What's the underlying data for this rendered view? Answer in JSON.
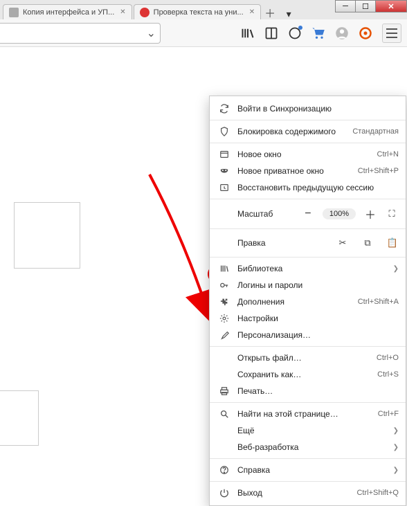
{
  "tabs": [
    {
      "title": "Копия интерфейса и УП..."
    },
    {
      "title": "Проверка текста на уни..."
    }
  ],
  "toolbar_icons": {
    "library": "library-icon",
    "reader": "reader-icon",
    "account_dot": "account-dot-icon",
    "cart": "cart-icon",
    "profile": "profile-icon",
    "orange": "orange-circle-icon"
  },
  "menu": {
    "sync": "Войти в Синхронизацию",
    "block": "Блокировка содержимого",
    "block_hint": "Стандартная",
    "new_window": "Новое окно",
    "new_window_sc": "Ctrl+N",
    "new_private": "Новое приватное окно",
    "new_private_sc": "Ctrl+Shift+P",
    "restore": "Восстановить предыдущую сессию",
    "zoom_label": "Масштаб",
    "zoom_value": "100%",
    "edit_label": "Правка",
    "library": "Библиотека",
    "logins": "Логины и пароли",
    "addons": "Дополнения",
    "addons_sc": "Ctrl+Shift+A",
    "settings": "Настройки",
    "personalize": "Персонализация…",
    "open_file": "Открыть файл…",
    "open_file_sc": "Ctrl+O",
    "save_as": "Сохранить как…",
    "save_as_sc": "Ctrl+S",
    "print": "Печать…",
    "find": "Найти на этой странице…",
    "find_sc": "Ctrl+F",
    "more": "Ещё",
    "webdev": "Веб-разработка",
    "help": "Справка",
    "exit": "Выход",
    "exit_sc": "Ctrl+Shift+Q"
  }
}
